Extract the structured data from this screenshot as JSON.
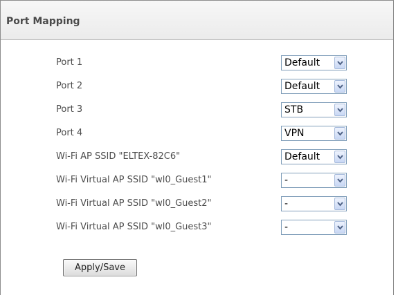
{
  "panel": {
    "title": "Port Mapping"
  },
  "rows": [
    {
      "label": "Port 1",
      "value": "Default"
    },
    {
      "label": "Port 2",
      "value": "Default"
    },
    {
      "label": "Port 3",
      "value": "STB"
    },
    {
      "label": "Port 4",
      "value": "VPN"
    },
    {
      "label": "Wi-Fi AP SSID \"ELTEX-82C6\"",
      "value": "Default"
    },
    {
      "label": "Wi-Fi Virtual AP SSID \"wl0_Guest1\"",
      "value": "-"
    },
    {
      "label": "Wi-Fi Virtual AP SSID \"wl0_Guest2\"",
      "value": "-"
    },
    {
      "label": "Wi-Fi Virtual AP SSID \"wl0_Guest3\"",
      "value": "-"
    }
  ],
  "actions": {
    "apply_label": "Apply/Save"
  },
  "icons": {
    "dropdown": "chevron-down-icon"
  },
  "colors": {
    "header_bg": "#ebebeb",
    "select_border": "#7f9db9",
    "arrow_button": "#c8d7f4",
    "chevron": "#4d6185"
  }
}
